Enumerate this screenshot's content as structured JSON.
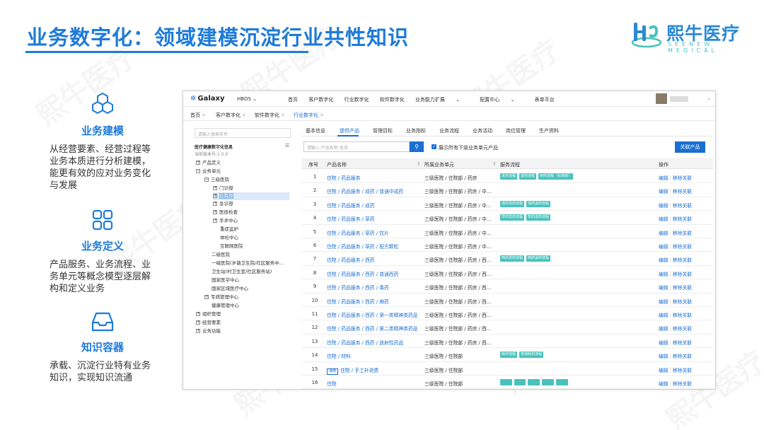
{
  "slide": {
    "title": "业务数字化：领域建模沉淀行业共性知识"
  },
  "logo": {
    "text_cn": "熙牛医疗",
    "text_en": "SEENEW MEDICAL"
  },
  "features": [
    {
      "icon": "cubes-icon",
      "heading": "业务建模",
      "desc": "从经营要素、经营过程等业务本质进行分析建模，能更有效的应对业务变化与发展"
    },
    {
      "icon": "grid-icon",
      "heading": "业务定义",
      "desc": "产品服务、业务流程、业务单元等概念模型逐层解构和定义业务"
    },
    {
      "icon": "inbox-icon",
      "heading": "知识容器",
      "desc": "承载、沉淀行业特有业务知识，实现知识流通"
    }
  ],
  "app": {
    "brand": "Galaxy",
    "hbos": "HBOS",
    "nav": [
      "首页",
      "客户数字化",
      "行业数字化",
      "软件数字化",
      "业务能力扩展",
      "配置中心",
      "表单平台"
    ],
    "page_tabs": [
      "首页",
      "客户数字化",
      "软件数字化",
      "行业数字化"
    ],
    "left": {
      "search_placeholder": "请输入搜索条件",
      "title": "医疗健康数字化信息",
      "version": "当前版本号:1.0.0",
      "tree": [
        "产品定义",
        "业务单元",
        "三级医院",
        "门诊部",
        "住院部",
        "急诊部",
        "医技检查",
        "手术中心",
        "重症监护",
        "体检中心",
        "互联网医院",
        "二级医院",
        "一级医院(乡镇卫生院/社区服务中...",
        "卫生站(村卫生室/社区服务站)",
        "国家医学中心",
        "国家区域医疗中心",
        "专病管理中心",
        "健康管理中心",
        "组织管理",
        "经营要素",
        "业务功能"
      ]
    },
    "subtabs": [
      "基本信息",
      "提供产品",
      "管理目标",
      "业务指标",
      "业务流程",
      "业务活动",
      "岗位管理",
      "生产资料"
    ],
    "product_search_placeholder": "请输入 产品名称 查询",
    "show_all_label": "展示所有下级业务单元产品",
    "associate_button": "关联产品",
    "table": {
      "headers": [
        "序号",
        "产品名称",
        "所属业务单元",
        "服务流程",
        "操作"
      ],
      "ops": [
        "编辑",
        "移除关联"
      ],
      "rows": [
        {
          "no": "1",
          "name": "住院 / 药品服务",
          "unit": "三级医院 / 住院部 / 药房",
          "flows": [
            "发药流程",
            "退药流程",
            "用药流程（标准版）"
          ]
        },
        {
          "no": "2",
          "name": "住院 / 药品服务 / 成药 / 普通中成药",
          "unit": "三级医院 / 住院部 / 药房 / 中...",
          "flows": []
        },
        {
          "no": "3",
          "name": "住院 / 药品服务 / 成药",
          "unit": "三级医院 / 住院部 / 药房 / 中...",
          "flows": [
            "成药发药流程",
            "成药退药流程"
          ]
        },
        {
          "no": "4",
          "name": "住院 / 药品服务 / 草药",
          "unit": "三级医院 / 住院部 / 药房 / 中...",
          "flows": [
            "草药发药流程",
            "草药退药流程"
          ]
        },
        {
          "no": "5",
          "name": "住院 / 药品服务 / 草药 / 饮片",
          "unit": "三级医院 / 住院部 / 药房 / 中...",
          "flows": []
        },
        {
          "no": "6",
          "name": "住院 / 药品服务 / 草药 / 配方颗粒",
          "unit": "三级医院 / 住院部 / 药房 / 中...",
          "flows": []
        },
        {
          "no": "7",
          "name": "住院 / 药品服务 / 西药",
          "unit": "三级医院 / 住院部 / 药房 / 西...",
          "flows": [
            "西药发药流程",
            "西药退药流程"
          ]
        },
        {
          "no": "8",
          "name": "住院 / 药品服务 / 西药 / 普通西药",
          "unit": "三级医院 / 住院部 / 药房 / 西...",
          "flows": []
        },
        {
          "no": "9",
          "name": "住院 / 药品服务 / 西药 / 毒药",
          "unit": "三级医院 / 住院部 / 药房 / 西...",
          "flows": []
        },
        {
          "no": "10",
          "name": "住院 / 药品服务 / 西药 / 麻药",
          "unit": "三级医院 / 住院部 / 药房 / 西...",
          "flows": []
        },
        {
          "no": "11",
          "name": "住院 / 药品服务 / 西药 / 第一类精神类药品",
          "unit": "三级医院 / 住院部 / 药房 / 西...",
          "flows": []
        },
        {
          "no": "12",
          "name": "住院 / 药品服务 / 西药 / 第二类精神类药品",
          "unit": "三级医院 / 住院部 / 药房 / 西...",
          "flows": []
        },
        {
          "no": "13",
          "name": "住院 / 药品服务 / 西药 / 放射性药品",
          "unit": "三级医院 / 住院部 / 药房 / 西...",
          "flows": []
        },
        {
          "no": "14",
          "name": "住院 / 材料",
          "unit": "三级医院 / 住院部",
          "flows": [
            "耗材流程",
            "普通耗材流程"
          ]
        },
        {
          "no": "15",
          "name": "住院 / 手工补退费",
          "unit": "三级医院 / 住院部",
          "flows": [],
          "badge": "通用"
        },
        {
          "no": "16",
          "name": "住院",
          "unit": "三级医院 / 住院部",
          "flows": [
            "",
            "",
            "",
            "",
            ""
          ]
        }
      ]
    }
  },
  "colors": {
    "accent": "#1d7bd9",
    "tag": "#49c2bd",
    "link": "#1a6fd0"
  }
}
